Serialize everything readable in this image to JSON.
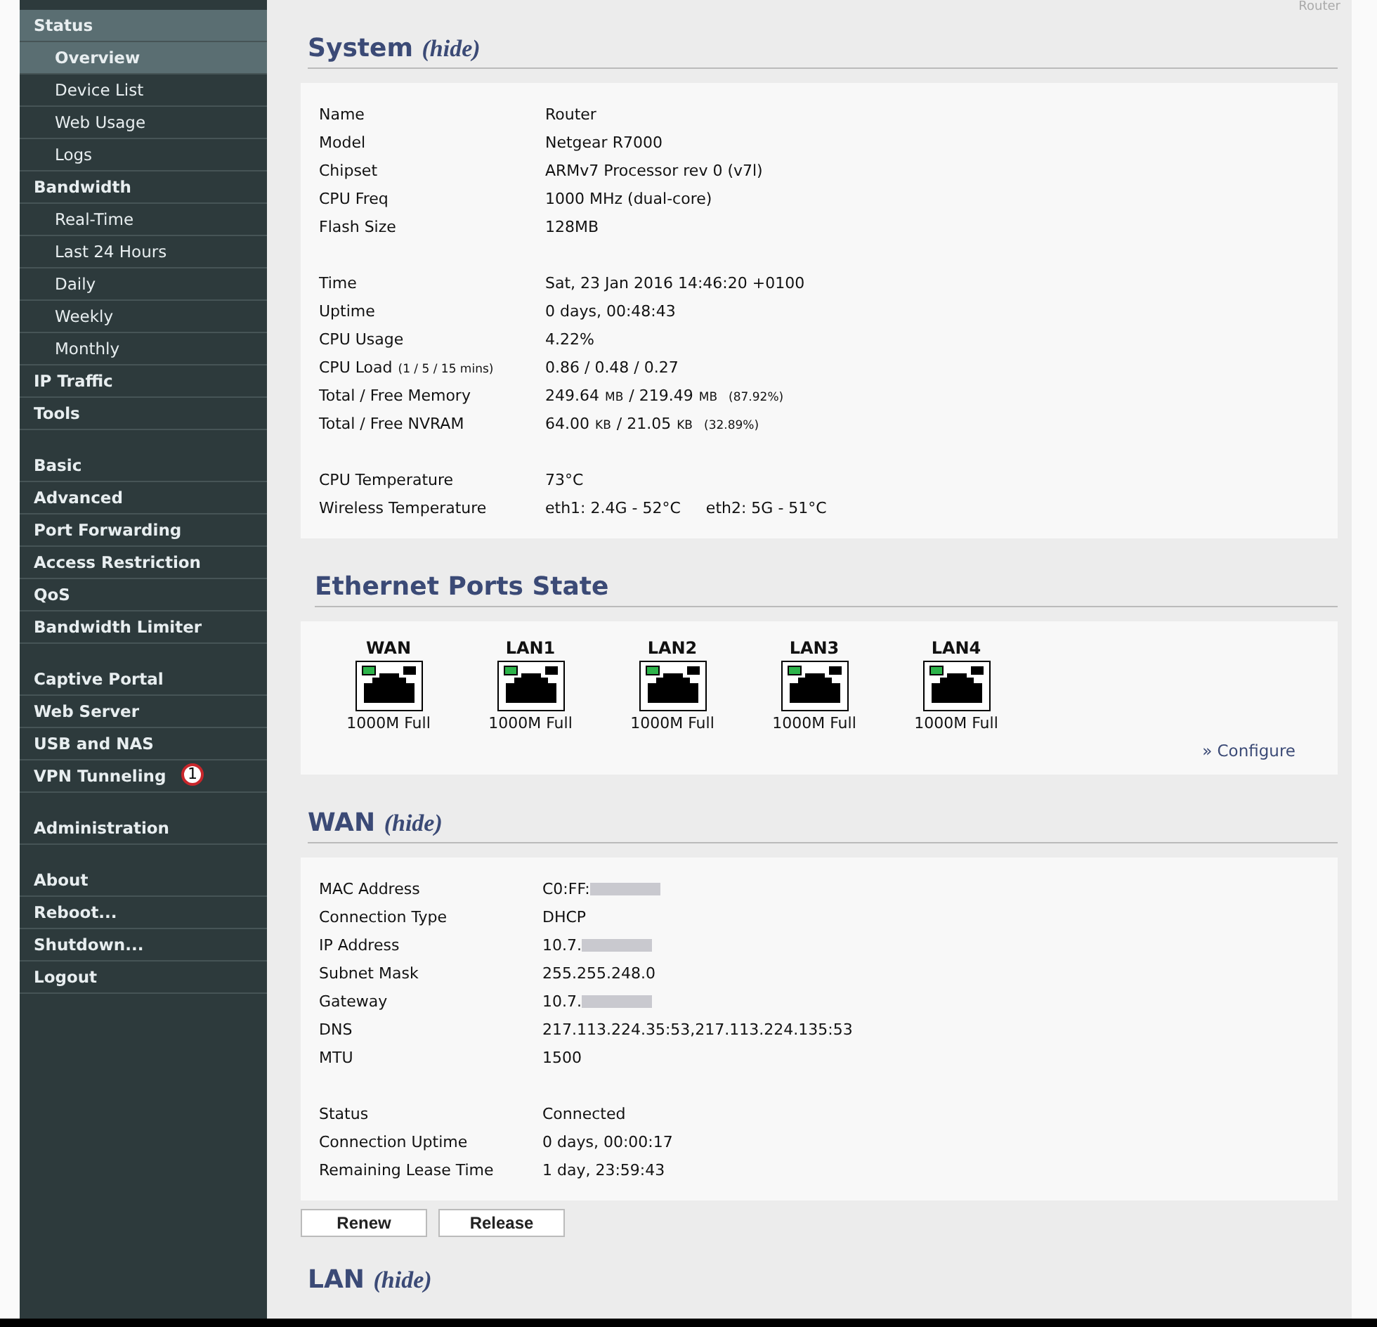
{
  "header": {
    "router_name": "Router"
  },
  "sidebar": {
    "sections": [
      [
        {
          "label": "Status",
          "kind": "group",
          "selected": true
        },
        {
          "label": "Overview",
          "kind": "sub",
          "selected": true
        },
        {
          "label": "Device List",
          "kind": "sub",
          "selected": false
        },
        {
          "label": "Web Usage",
          "kind": "sub",
          "selected": false
        },
        {
          "label": "Logs",
          "kind": "sub",
          "selected": false
        },
        {
          "label": "Bandwidth",
          "kind": "group",
          "selected": false
        },
        {
          "label": "Real-Time",
          "kind": "sub",
          "selected": false
        },
        {
          "label": "Last 24 Hours",
          "kind": "sub",
          "selected": false
        },
        {
          "label": "Daily",
          "kind": "sub",
          "selected": false
        },
        {
          "label": "Weekly",
          "kind": "sub",
          "selected": false
        },
        {
          "label": "Monthly",
          "kind": "sub",
          "selected": false
        },
        {
          "label": "IP Traffic",
          "kind": "group",
          "selected": false
        },
        {
          "label": "Tools",
          "kind": "group",
          "selected": false
        }
      ],
      [
        {
          "label": "Basic",
          "kind": "group",
          "selected": false
        },
        {
          "label": "Advanced",
          "kind": "group",
          "selected": false
        },
        {
          "label": "Port Forwarding",
          "kind": "group",
          "selected": false
        },
        {
          "label": "Access Restriction",
          "kind": "group",
          "selected": false
        },
        {
          "label": "QoS",
          "kind": "group",
          "selected": false
        },
        {
          "label": "Bandwidth Limiter",
          "kind": "group",
          "selected": false
        }
      ],
      [
        {
          "label": "Captive Portal",
          "kind": "group",
          "selected": false
        },
        {
          "label": "Web Server",
          "kind": "group",
          "selected": false
        },
        {
          "label": "USB and NAS",
          "kind": "group",
          "selected": false
        },
        {
          "label": "VPN Tunneling",
          "kind": "group",
          "selected": false,
          "badge": "1"
        }
      ],
      [
        {
          "label": "Administration",
          "kind": "group",
          "selected": false
        }
      ],
      [
        {
          "label": "About",
          "kind": "group",
          "selected": false
        },
        {
          "label": "Reboot...",
          "kind": "group",
          "selected": false
        },
        {
          "label": "Shutdown...",
          "kind": "group",
          "selected": false
        },
        {
          "label": "Logout",
          "kind": "group",
          "selected": false
        }
      ]
    ]
  },
  "system": {
    "title": "System",
    "toggle": "(hide)",
    "groups": [
      [
        {
          "label": "Name",
          "value": [
            {
              "text": "Router",
              "kind": "text"
            }
          ]
        },
        {
          "label": "Model",
          "value": [
            {
              "text": "Netgear R7000",
              "kind": "text"
            }
          ]
        },
        {
          "label": "Chipset",
          "value": [
            {
              "text": "ARMv7 Processor rev 0 (v7l)",
              "kind": "text"
            }
          ]
        },
        {
          "label": "CPU Freq",
          "value": [
            {
              "text": "1000 MHz (dual-core)",
              "kind": "text"
            }
          ]
        },
        {
          "label": "Flash Size",
          "value": [
            {
              "text": "128MB",
              "kind": "text"
            }
          ]
        }
      ],
      [
        {
          "label": "Time",
          "value": [
            {
              "text": "Sat, 23 Jan 2016 14:46:20 +0100",
              "kind": "text"
            }
          ]
        },
        {
          "label": "Uptime",
          "value": [
            {
              "text": "0 days, 00:48:43",
              "kind": "text"
            }
          ]
        },
        {
          "label": "CPU Usage",
          "value": [
            {
              "text": "4.22%",
              "kind": "text"
            }
          ]
        },
        {
          "label": "CPU Load",
          "label_note": "(1 / 5 / 15 mins)",
          "value": [
            {
              "text": "0.86 / 0.48 / 0.27",
              "kind": "text"
            }
          ]
        },
        {
          "label": "Total / Free Memory",
          "value": [
            {
              "text": "249.64",
              "kind": "text"
            },
            {
              "text": "MB",
              "kind": "unit"
            },
            {
              "text": "/ 219.49",
              "kind": "text"
            },
            {
              "text": "MB",
              "kind": "unit"
            },
            {
              "text": "(87.92%)",
              "kind": "note"
            }
          ]
        },
        {
          "label": "Total / Free NVRAM",
          "value": [
            {
              "text": "64.00",
              "kind": "text"
            },
            {
              "text": "KB",
              "kind": "unit"
            },
            {
              "text": "/ 21.05",
              "kind": "text"
            },
            {
              "text": "KB",
              "kind": "unit"
            },
            {
              "text": "(32.89%)",
              "kind": "note"
            }
          ]
        }
      ],
      [
        {
          "label": "CPU Temperature",
          "value": [
            {
              "text": "73°C",
              "kind": "text"
            }
          ]
        },
        {
          "label": "Wireless Temperature",
          "value": [
            {
              "text": "eth1: 2.4G - 52°C",
              "kind": "field"
            },
            {
              "text": "eth2: 5G - 51°C",
              "kind": "field"
            }
          ]
        }
      ]
    ]
  },
  "ethernet": {
    "title": "Ethernet Ports State",
    "ports": [
      {
        "label": "WAN",
        "speed": "1000M Full",
        "link": true
      },
      {
        "label": "LAN1",
        "speed": "1000M Full",
        "link": true
      },
      {
        "label": "LAN2",
        "speed": "1000M Full",
        "link": true
      },
      {
        "label": "LAN3",
        "speed": "1000M Full",
        "link": true
      },
      {
        "label": "LAN4",
        "speed": "1000M Full",
        "link": true
      }
    ],
    "configure_link": "» Configure"
  },
  "wan": {
    "title": "WAN",
    "toggle": "(hide)",
    "groups": [
      [
        {
          "label": "MAC Address",
          "value": [
            {
              "text": "C0:FF:",
              "kind": "text"
            },
            {
              "kind": "redacted"
            }
          ]
        },
        {
          "label": "Connection Type",
          "value": [
            {
              "text": "DHCP",
              "kind": "text"
            }
          ]
        },
        {
          "label": "IP Address",
          "value": [
            {
              "text": "10.7.",
              "kind": "text"
            },
            {
              "kind": "redacted"
            }
          ]
        },
        {
          "label": "Subnet Mask",
          "value": [
            {
              "text": "255.255.248.0",
              "kind": "text"
            }
          ]
        },
        {
          "label": "Gateway",
          "value": [
            {
              "text": "10.7.",
              "kind": "text"
            },
            {
              "kind": "redacted"
            }
          ]
        },
        {
          "label": "DNS",
          "value": [
            {
              "text": "217.113.224.35:53,217.113.224.135:53",
              "kind": "text"
            }
          ]
        },
        {
          "label": "MTU",
          "value": [
            {
              "text": "1500",
              "kind": "text"
            }
          ]
        }
      ],
      [
        {
          "label": "Status",
          "value": [
            {
              "text": "Connected",
              "kind": "text"
            }
          ]
        },
        {
          "label": "Connection Uptime",
          "value": [
            {
              "text": "0 days, 00:00:17",
              "kind": "text"
            }
          ]
        },
        {
          "label": "Remaining Lease Time",
          "value": [
            {
              "text": "1 day, 23:59:43",
              "kind": "text"
            }
          ]
        }
      ]
    ],
    "buttons": [
      "Renew",
      "Release"
    ]
  },
  "lan": {
    "title": "LAN",
    "toggle": "(hide)"
  }
}
